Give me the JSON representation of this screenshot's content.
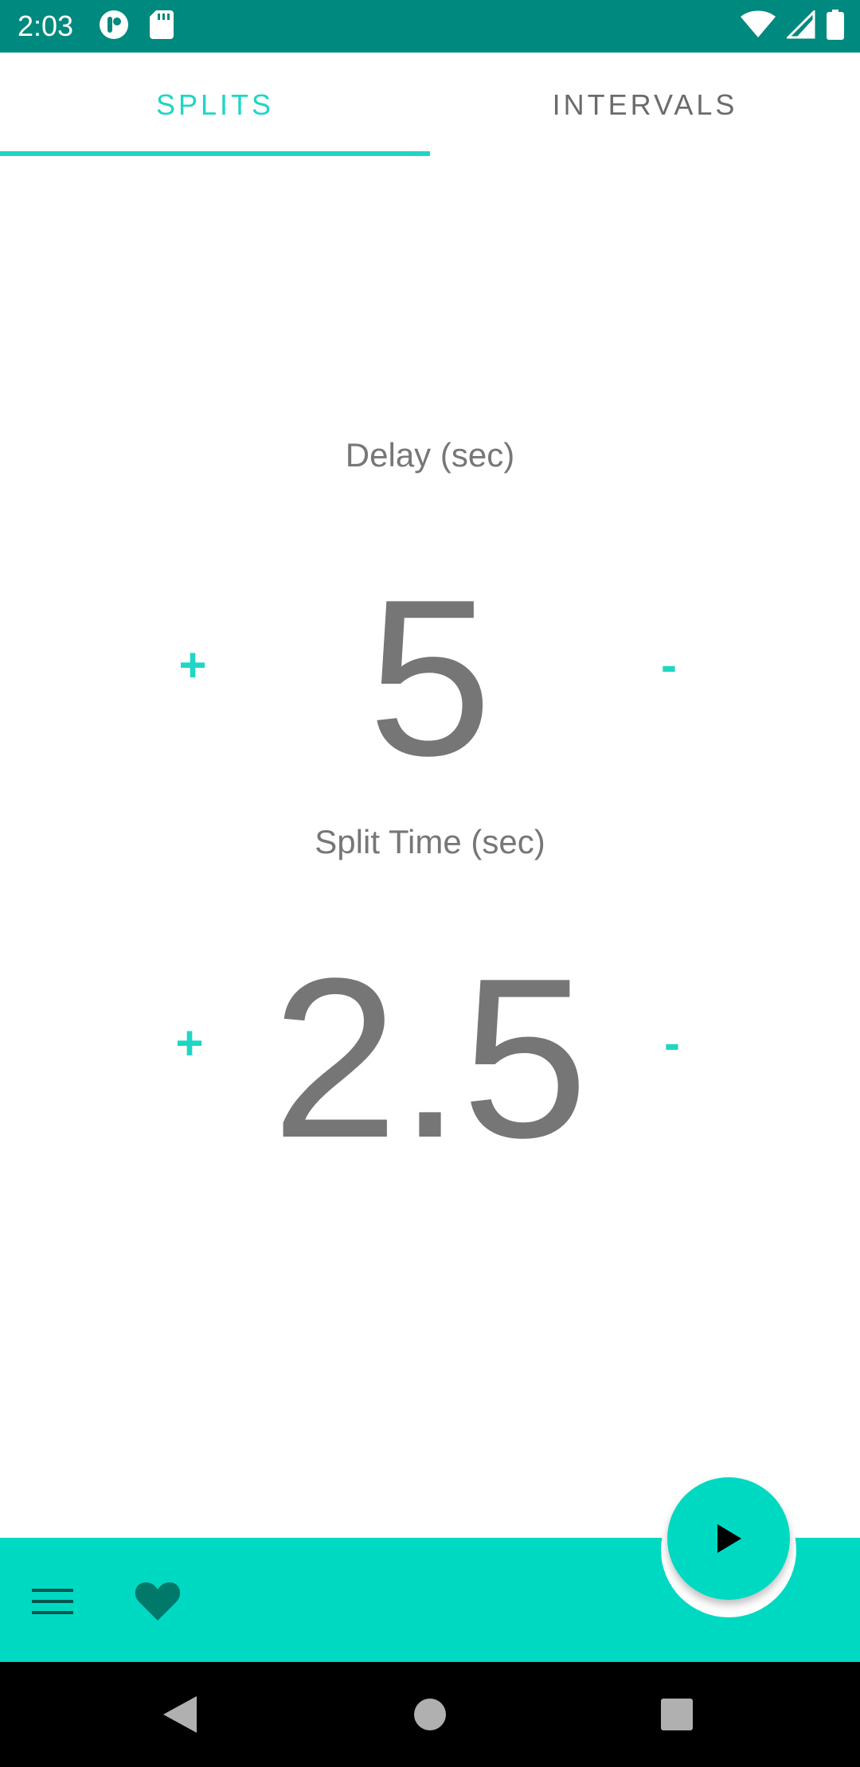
{
  "status_bar": {
    "time": "2:03",
    "icons": [
      "app-notification-icon",
      "sd-card-icon",
      "wifi-icon",
      "cell-signal-icon",
      "battery-icon"
    ]
  },
  "tabs": [
    {
      "label": "SPLITS",
      "selected": true
    },
    {
      "label": "INTERVALS",
      "selected": false
    }
  ],
  "delay": {
    "label": "Delay (sec)",
    "value": "5",
    "increment_label": "+",
    "decrement_label": "-"
  },
  "split_time": {
    "label": "Split Time (sec)",
    "value": "2.5",
    "increment_label": "+",
    "decrement_label": "-"
  },
  "bottom_bar": {
    "icons": [
      "menu-icon",
      "heart-icon"
    ],
    "fab_icon": "play-icon"
  },
  "nav_bar": {
    "icons": [
      "back-icon",
      "home-icon",
      "recents-icon"
    ]
  },
  "colors": {
    "status_bar": "#00897e",
    "accent": "#1fd6c4",
    "bottom_bar": "#00d9c2",
    "heart": "#00796b",
    "text_gray": "#767676"
  }
}
